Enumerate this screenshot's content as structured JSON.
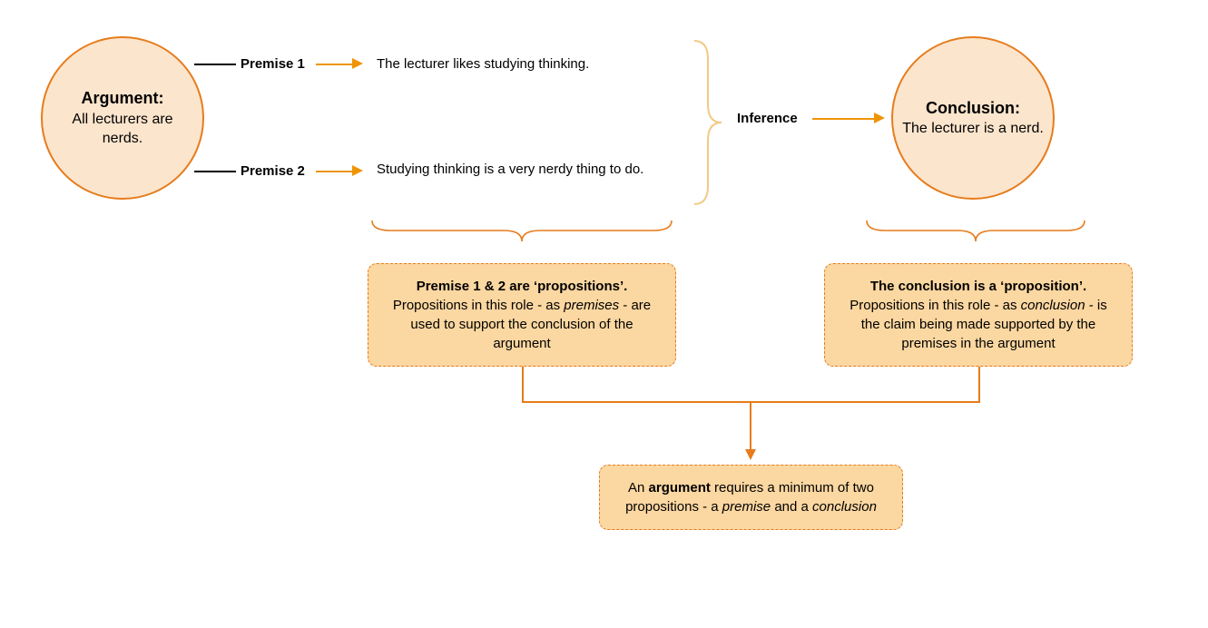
{
  "argument": {
    "title": "Argument:",
    "body": "All lecturers are nerds."
  },
  "premise1": {
    "label": "Premise 1",
    "text": "The lecturer likes studying thinking."
  },
  "premise2": {
    "label": "Premise 2",
    "text": "Studying thinking is a very nerdy thing to do."
  },
  "inference": {
    "label": "Inference"
  },
  "conclusion": {
    "title": "Conclusion:",
    "body": "The lecturer is a nerd."
  },
  "annotation_premises": {
    "title": "Premise 1 & 2 are ‘propositions’.",
    "line1_a": "Propositions in this role - as ",
    "line1_em": "premises",
    "line1_b": " - are used to support the conclusion of the argument"
  },
  "annotation_conclusion": {
    "title": "The conclusion is a ‘proposition’.",
    "line1_a": "Propositions in this role - as ",
    "line1_em": "conclusion",
    "line1_b": " -  is the claim being made supported by the premises in the argument"
  },
  "annotation_summary": {
    "a": "An ",
    "strong": "argument",
    "b": " requires a minimum of two propositions - a ",
    "em1": "premise",
    "c": " and a ",
    "em2": "conclusion"
  },
  "colors": {
    "fill": "#fce5cd",
    "stroke": "#e67c1c",
    "arrow": "#ef9405",
    "braceLight": "#f2ca86"
  }
}
